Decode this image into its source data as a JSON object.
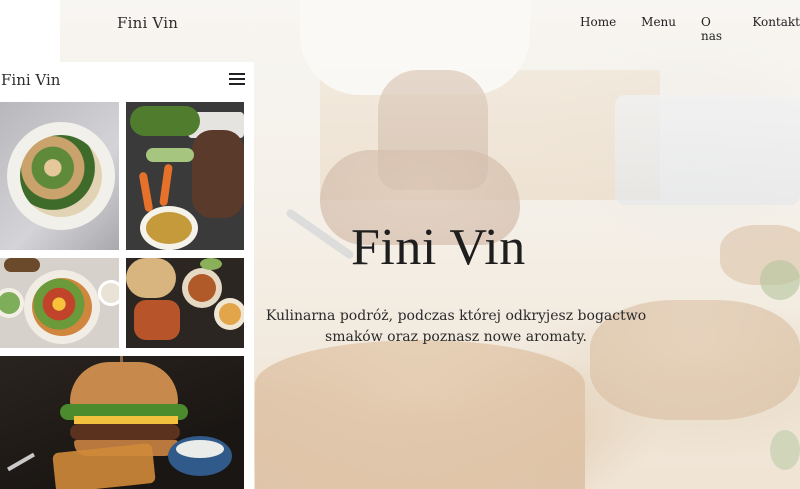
{
  "header": {
    "brand": "Fini Vin",
    "nav": [
      {
        "label": "Home"
      },
      {
        "label": "Menu"
      },
      {
        "label": "O nas"
      },
      {
        "label": "Kontakt"
      }
    ]
  },
  "hero": {
    "title": "Fini Vin",
    "subtitle_line1": "Kulinarna podróż, podczas której odkryjesz bogactwo",
    "subtitle_line2": "smaków oraz poznasz nowe aromaty."
  },
  "mobile_panel": {
    "brand": "Fini Vin",
    "menu_icon": "hamburger-menu-icon"
  },
  "colors": {
    "text": "#222222",
    "panel_background": "#ffffff"
  }
}
